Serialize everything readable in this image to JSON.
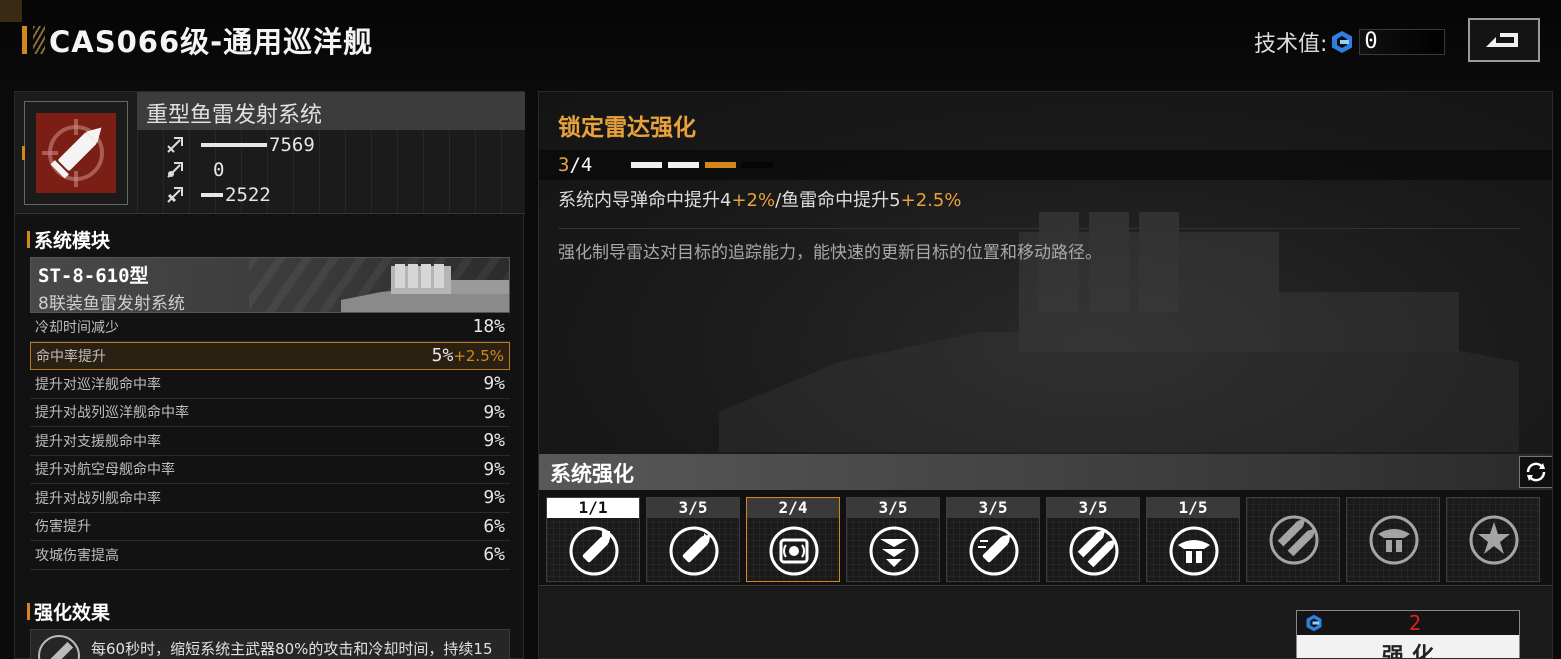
{
  "header": {
    "title": "CAS066级-通用巡洋舰",
    "tech_label": "技术值:",
    "tech_value": "0",
    "tech_icon": "tech-point-icon",
    "back_icon": "back-icon"
  },
  "system": {
    "name": "重型鱼雷发射系统",
    "icon": "torpedo-icon",
    "stats": [
      {
        "icon": "damage-icon",
        "value": "7569",
        "fill": 0.6
      },
      {
        "icon": "penetration-icon",
        "value": "0",
        "fill": 0
      },
      {
        "icon": "accuracy-icon",
        "value": "2522",
        "fill": 0.2
      }
    ]
  },
  "modules": {
    "section_label": "系统模块",
    "module_name": "ST-8-610型",
    "module_desc": "8联装鱼雷发射系统",
    "attributes": [
      {
        "name": "冷却时间减少",
        "value": "18%",
        "bonus": ""
      },
      {
        "name": "命中率提升",
        "value": "5%",
        "bonus": "+2.5%"
      },
      {
        "name": "提升对巡洋舰命中率",
        "value": "9%",
        "bonus": ""
      },
      {
        "name": "提升对战列巡洋舰命中率",
        "value": "9%",
        "bonus": ""
      },
      {
        "name": "提升对支援舰命中率",
        "value": "9%",
        "bonus": ""
      },
      {
        "name": "提升对航空母舰命中率",
        "value": "9%",
        "bonus": ""
      },
      {
        "name": "提升对战列舰命中率",
        "value": "9%",
        "bonus": ""
      },
      {
        "name": "伤害提升",
        "value": "6%",
        "bonus": ""
      },
      {
        "name": "攻城伤害提高",
        "value": "6%",
        "bonus": ""
      }
    ]
  },
  "effects": {
    "section_label": "强化效果",
    "text": "每60秒时，缩短系统主武器80%的攻击和冷却时间，持续15"
  },
  "upgrade": {
    "title": "锁定雷达强化",
    "level_current": "3",
    "level_max": "/4",
    "progress": {
      "current": 3,
      "max": 4
    },
    "effect_a": "系统内导弹命中提升4",
    "effect_a_bonus": "+2%",
    "effect_b": "/鱼雷命中提升5",
    "effect_b_bonus": "+2.5%",
    "description": "强化制导雷达对目标的追踪能力，能快速的更新目标的位置和移动路径。"
  },
  "strengthen": {
    "title": "系统强化",
    "refresh_icon": "refresh-icon",
    "slots": [
      {
        "level": "1/1",
        "icon": "torpedo-upgrade-icon",
        "locked": false,
        "selected": false,
        "full": true
      },
      {
        "level": "3/5",
        "icon": "torpedo-boost-icon",
        "locked": false,
        "selected": false,
        "full": false
      },
      {
        "level": "2/4",
        "icon": "radar-chip-icon",
        "locked": false,
        "selected": true,
        "full": false
      },
      {
        "level": "3/5",
        "icon": "armor-pierce-icon",
        "locked": false,
        "selected": false,
        "full": false
      },
      {
        "level": "3/5",
        "icon": "torpedo-speed-icon",
        "locked": false,
        "selected": false,
        "full": false
      },
      {
        "level": "3/5",
        "icon": "twin-missile-icon",
        "locked": false,
        "selected": false,
        "full": false
      },
      {
        "level": "1/5",
        "icon": "turret-icon",
        "locked": false,
        "selected": false,
        "full": false
      },
      {
        "level": "",
        "icon": "twin-missile-icon",
        "locked": true,
        "selected": false,
        "full": false
      },
      {
        "level": "",
        "icon": "turret-icon",
        "locked": true,
        "selected": false,
        "full": false
      },
      {
        "level": "",
        "icon": "burst-icon",
        "locked": true,
        "selected": false,
        "full": false
      }
    ]
  },
  "enhance": {
    "cost_icon": "tech-point-icon",
    "cost": "2",
    "label": "强化"
  },
  "colors": {
    "accent": "#d4881c",
    "highlight_text": "#e8a23a",
    "cost_red": "#e02020",
    "system_icon_bg": "#7a1e16"
  }
}
